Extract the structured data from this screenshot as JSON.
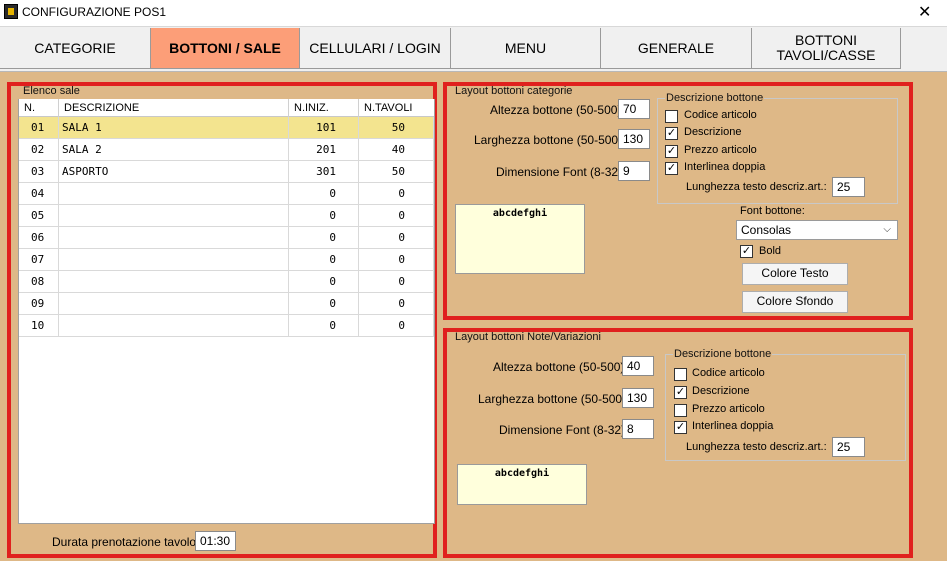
{
  "window": {
    "title": "CONFIGURAZIONE POS1",
    "close_glyph": "✕"
  },
  "tabs": [
    {
      "label": "CATEGORIE",
      "active": false
    },
    {
      "label": "BOTTONI / SALE",
      "active": true
    },
    {
      "label": "CELLULARI / LOGIN",
      "active": false
    },
    {
      "label": "MENU",
      "active": false
    },
    {
      "label": "GENERALE",
      "active": false
    },
    {
      "label": "BOTTONI\nTAVOLI/CASSE",
      "active": false
    }
  ],
  "sale": {
    "legend": "Elenco sale",
    "columns": [
      "N.",
      "DESCRIZIONE",
      "N.INIZ.",
      "N.TAVOLI"
    ],
    "rows": [
      {
        "n": "01",
        "desc": "SALA 1",
        "iniz": "101",
        "tavoli": "50",
        "selected": true
      },
      {
        "n": "02",
        "desc": "SALA 2",
        "iniz": "201",
        "tavoli": "40",
        "selected": false
      },
      {
        "n": "03",
        "desc": "ASPORTO",
        "iniz": "301",
        "tavoli": "50",
        "selected": false
      },
      {
        "n": "04",
        "desc": "",
        "iniz": "0",
        "tavoli": "0",
        "selected": false
      },
      {
        "n": "05",
        "desc": "",
        "iniz": "0",
        "tavoli": "0",
        "selected": false
      },
      {
        "n": "06",
        "desc": "",
        "iniz": "0",
        "tavoli": "0",
        "selected": false
      },
      {
        "n": "07",
        "desc": "",
        "iniz": "0",
        "tavoli": "0",
        "selected": false
      },
      {
        "n": "08",
        "desc": "",
        "iniz": "0",
        "tavoli": "0",
        "selected": false
      },
      {
        "n": "09",
        "desc": "",
        "iniz": "0",
        "tavoli": "0",
        "selected": false
      },
      {
        "n": "10",
        "desc": "",
        "iniz": "0",
        "tavoli": "0",
        "selected": false
      }
    ],
    "durata_label": "Durata prenotazione tavolo:",
    "durata_value": "01:30"
  },
  "categorie": {
    "legend": "Layout bottoni categorie",
    "altezza_label": "Altezza bottone (50-500):",
    "altezza_value": "70",
    "larghezza_label": "Larghezza bottone (50-500):",
    "larghezza_value": "130",
    "font_label": "Dimensione Font (8-32):",
    "font_value": "9",
    "desc_legend": "Descrizione bottone",
    "checks": [
      {
        "label": "Codice articolo",
        "checked": false
      },
      {
        "label": "Descrizione",
        "checked": true
      },
      {
        "label": "Prezzo articolo",
        "checked": true
      },
      {
        "label": "Interlinea doppia",
        "checked": true
      }
    ],
    "lunghezza_label": "Lunghezza testo descriz.art.:",
    "lunghezza_value": "25",
    "preview_text": "abcdefghi",
    "font_bottone_label": "Font bottone:",
    "font_select_value": "Consolas",
    "bold_label": "Bold",
    "bold_checked": true,
    "colore_testo_label": "Colore Testo",
    "colore_sfondo_label": "Colore Sfondo"
  },
  "note": {
    "legend": "Layout bottoni Note/Variazioni",
    "altezza_label": "Altezza bottone (50-500):",
    "altezza_value": "40",
    "larghezza_label": "Larghezza bottone (50-500):",
    "larghezza_value": "130",
    "font_label": "Dimensione Font (8-32):",
    "font_value": "8",
    "desc_legend": "Descrizione bottone",
    "checks": [
      {
        "label": "Codice articolo",
        "checked": false
      },
      {
        "label": "Descrizione",
        "checked": true
      },
      {
        "label": "Prezzo articolo",
        "checked": false
      },
      {
        "label": "Interlinea doppia",
        "checked": true
      }
    ],
    "lunghezza_label": "Lunghezza testo descriz.art.:",
    "lunghezza_value": "25",
    "preview_text": "abcdefghi"
  },
  "colors": {
    "background": "#deb887",
    "active_tab": "#fc9e78",
    "highlight_border": "#e0201e",
    "selected_row": "#f3e48f",
    "preview_bg": "#ffffdc"
  },
  "icons": {
    "app": "app-icon",
    "close": "close-icon",
    "check": "checkmark-icon",
    "dropdown": "chevron-down-icon"
  }
}
